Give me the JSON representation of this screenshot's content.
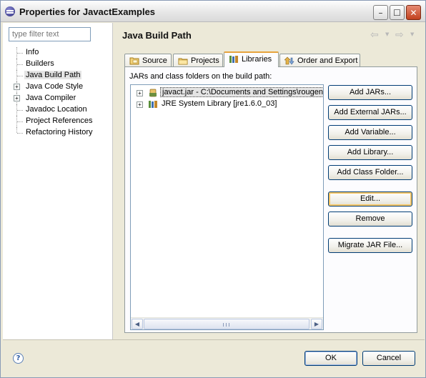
{
  "window": {
    "title": "Properties for JavactExamples",
    "app_icon": "eclipse-icon",
    "controls": {
      "minimize": "minimize-icon",
      "maximize": "maximize-icon",
      "close": "close-icon"
    }
  },
  "left_pane": {
    "filter_placeholder": "type filter text",
    "tree": [
      {
        "label": "Info",
        "expandable": false
      },
      {
        "label": "Builders",
        "expandable": false
      },
      {
        "label": "Java Build Path",
        "expandable": false,
        "selected": true
      },
      {
        "label": "Java Code Style",
        "expandable": true
      },
      {
        "label": "Java Compiler",
        "expandable": true
      },
      {
        "label": "Javadoc Location",
        "expandable": false
      },
      {
        "label": "Project References",
        "expandable": false
      },
      {
        "label": "Refactoring History",
        "expandable": false
      }
    ]
  },
  "main": {
    "title": "Java Build Path",
    "nav": {
      "back_icon": "arrow-left-icon",
      "forward_icon": "arrow-right-icon"
    },
    "tabs": [
      {
        "label": "Source",
        "icon": "source-folder-icon"
      },
      {
        "label": "Projects",
        "icon": "projects-icon"
      },
      {
        "label": "Libraries",
        "icon": "libraries-icon",
        "active": true
      },
      {
        "label": "Order and Export",
        "icon": "order-export-icon"
      }
    ],
    "caption": "JARs and class folders on the build path:",
    "libraries": [
      {
        "label": "javact.jar - C:\\Documents and Settings\\rougen",
        "icon": "jar-icon",
        "selected": true
      },
      {
        "label": "JRE System Library [jre1.6.0_03]",
        "icon": "library-icon"
      }
    ],
    "buttons": {
      "add_jars": "Add JARs...",
      "add_external_jars": "Add External JARs...",
      "add_variable": "Add Variable...",
      "add_library": "Add Library...",
      "add_class_folder": "Add Class Folder...",
      "edit": "Edit...",
      "remove": "Remove",
      "migrate_jar": "Migrate JAR File..."
    }
  },
  "footer": {
    "help_icon": "help-icon",
    "ok": "OK",
    "cancel": "Cancel"
  },
  "colors": {
    "active_tab_accent": "#e7a33c",
    "button_border": "#003c74",
    "panel_background": "#ece9d8"
  }
}
